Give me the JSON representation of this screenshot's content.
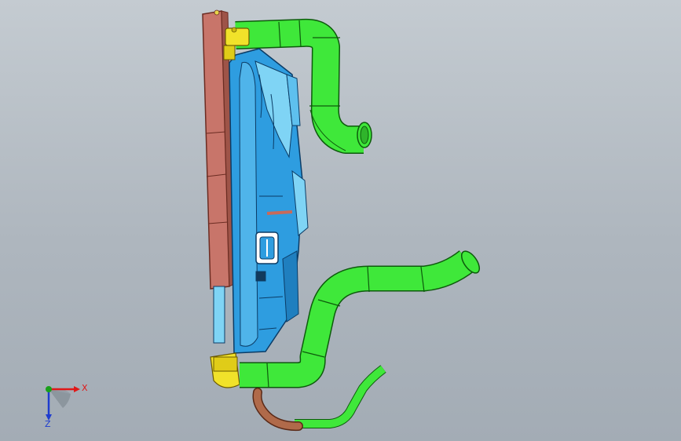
{
  "viewport": {
    "background_top": "#c4cbd1",
    "background_bottom": "#a3acb5"
  },
  "model": {
    "colors": {
      "radiator": "#c8756a",
      "radiator_edge": "#6b2c22",
      "shroud": "#2e9de0",
      "shroud_light": "#7fd4f5",
      "hose": "#3fe83a",
      "hose_edge": "#0d5a0c",
      "tank_yellow": "#f1e22a",
      "brown_pipe": "#b06a4a"
    }
  },
  "triad": {
    "x_label": "X",
    "z_label": "Z",
    "x_color": "#e01818",
    "y_color": "#1aa01a",
    "z_color": "#1e3ccf"
  }
}
